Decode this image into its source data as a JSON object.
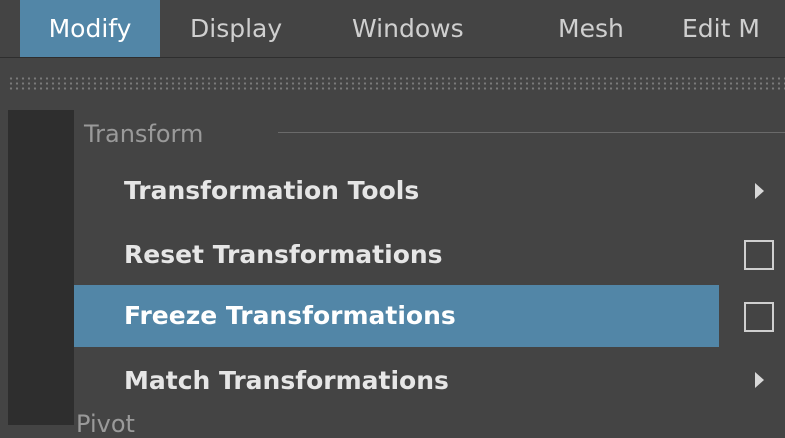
{
  "menubar": {
    "items": [
      {
        "label": "Modify",
        "active": true
      },
      {
        "label": "Display"
      },
      {
        "label": "Windows"
      },
      {
        "label": "Mesh"
      },
      {
        "label": "Edit M"
      }
    ]
  },
  "menu": {
    "section_title": "Transform",
    "items": [
      {
        "label": "Transformation Tools",
        "trailing": "submenu-arrow"
      },
      {
        "label": "Reset Transformations",
        "trailing": "option-box"
      },
      {
        "label": "Freeze Transformations",
        "trailing": "option-box",
        "highlighted": true
      },
      {
        "label": "Match Transformations",
        "trailing": "submenu-arrow"
      }
    ],
    "next_section_partial": "Pivot"
  },
  "colors": {
    "background": "#444444",
    "highlight": "#5286a7",
    "gutter": "#2e2e2e",
    "text": "#e6e6e6",
    "section_text": "#9a9a9a"
  }
}
